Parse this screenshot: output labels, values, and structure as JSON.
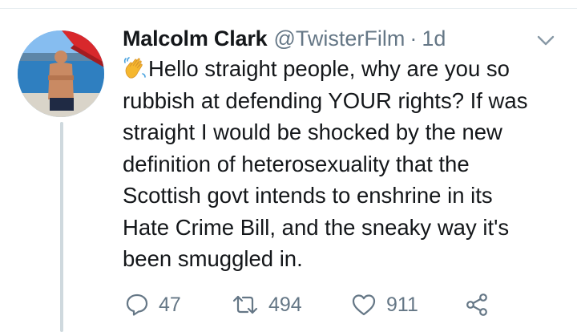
{
  "tweet": {
    "author": {
      "display_name": "Malcolm Clark",
      "handle": "@TwisterFilm"
    },
    "separator": "·",
    "timestamp": "1d",
    "text_lines": [
      "Hello straight people, why are you so",
      "rubbish at defending YOUR rights? If was",
      "straight I would be shocked by the new",
      "definition of heterosexuality that the",
      "Scottish govt intends to enshrine in its",
      "Hate Crime Bill, and the sneaky way it's",
      "been smuggled in."
    ],
    "leading_emoji": "waving-hand-emoji",
    "actions": {
      "replies": "47",
      "retweets": "494",
      "likes": "911"
    }
  },
  "icons": {
    "caret": "chevron-down-icon",
    "reply": "reply-icon",
    "retweet": "retweet-icon",
    "like": "heart-icon",
    "share": "share-icon"
  },
  "colors": {
    "text_primary": "#14171a",
    "text_secondary": "#657786",
    "thread_line": "#cfd9de",
    "emoji": "#f5b72f"
  }
}
